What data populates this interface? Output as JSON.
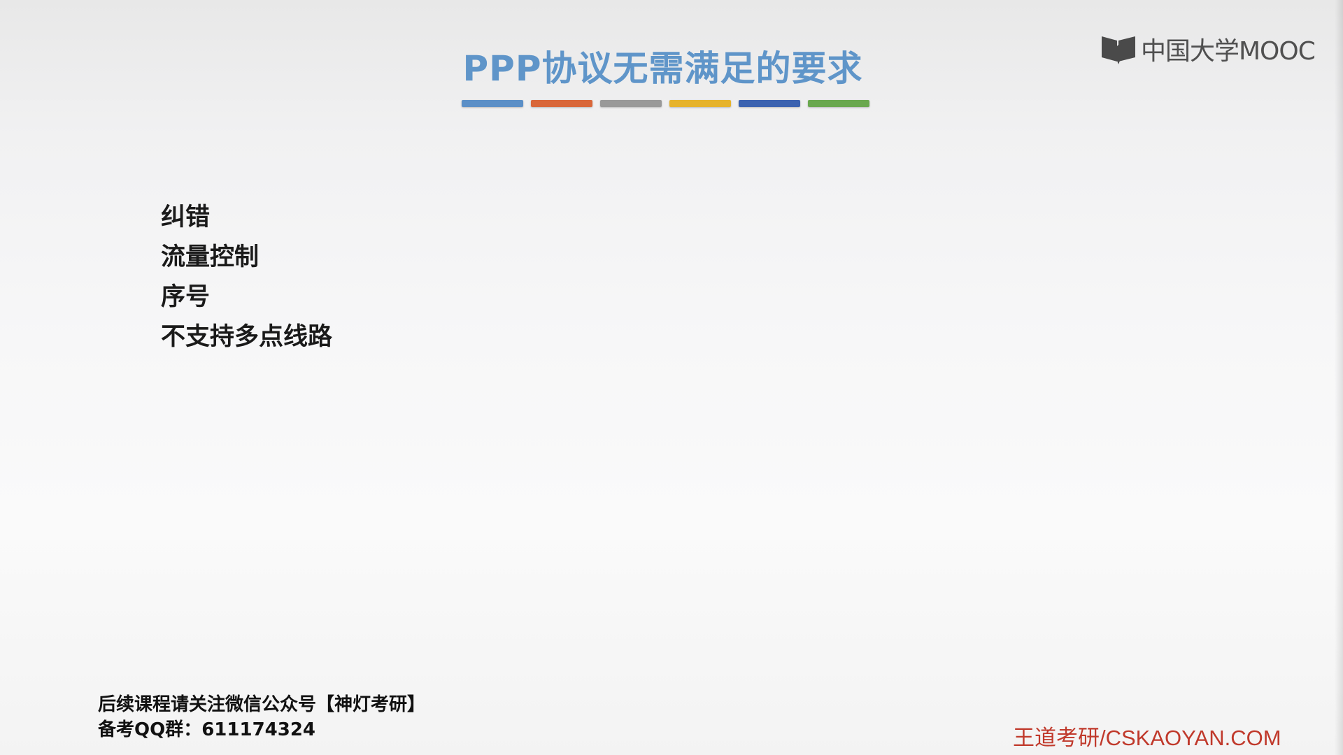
{
  "slide": {
    "title": "PPP协议无需满足的要求",
    "color_bar": [
      "#5b8fc7",
      "#d9673a",
      "#999999",
      "#e6b32c",
      "#3b62b0",
      "#6aa84f"
    ],
    "items": [
      "纠错",
      "流量控制",
      "序号",
      "不支持多点线路"
    ]
  },
  "logo": {
    "icon": "mooc-book-icon",
    "text": "中国大学MOOC"
  },
  "footer": {
    "line1": "后续课程请关注微信公众号【神灯考研】",
    "line2": "备考QQ群：611174324",
    "brand": "王道考研/CSKAOYAN.COM"
  }
}
